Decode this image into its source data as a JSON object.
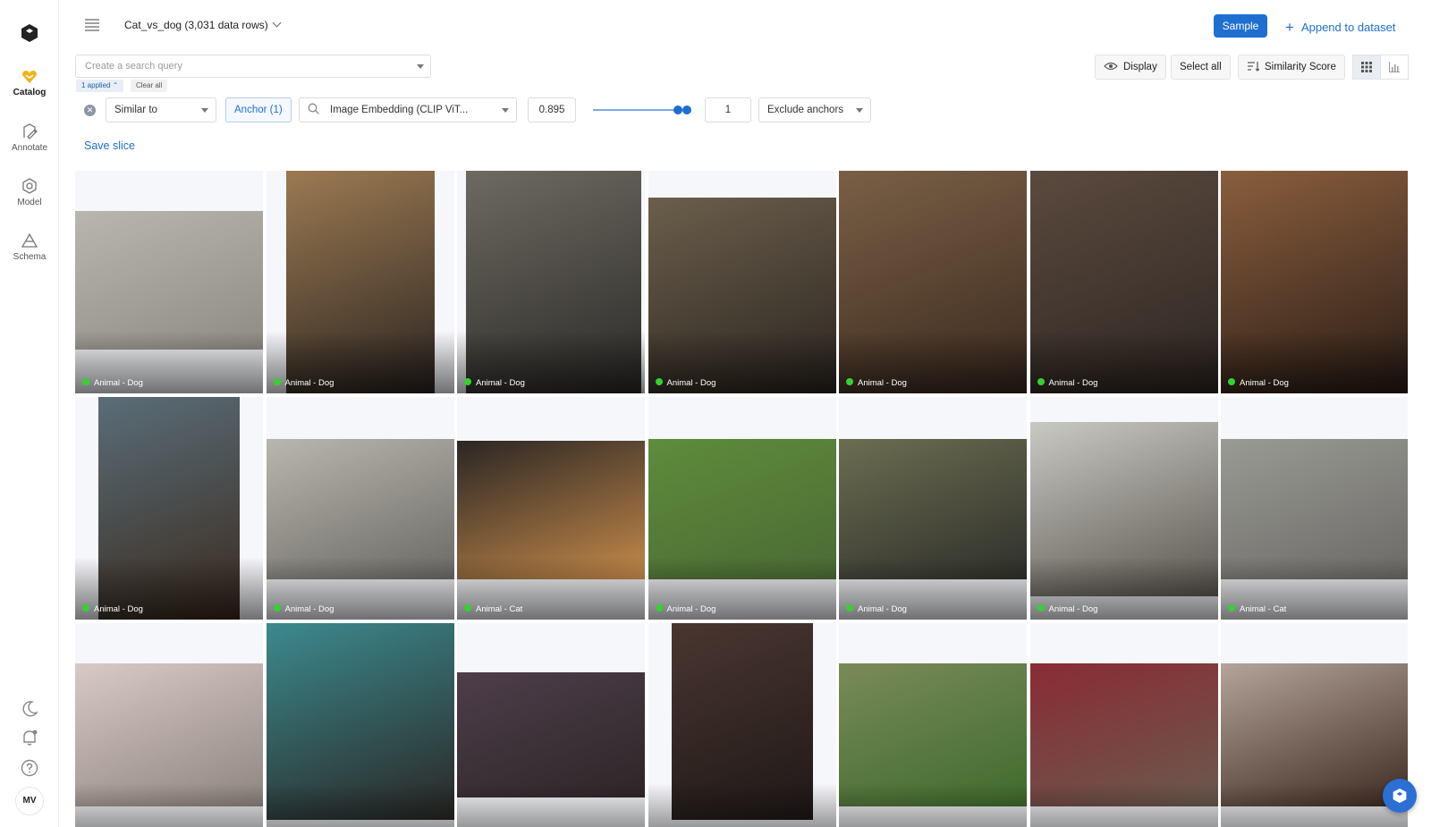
{
  "sidebar": {
    "items": [
      {
        "label": "Catalog",
        "icon": "catalog-icon",
        "active": true
      },
      {
        "label": "Annotate",
        "icon": "annotate-icon",
        "active": false
      },
      {
        "label": "Model",
        "icon": "model-icon",
        "active": false
      },
      {
        "label": "Schema",
        "icon": "schema-icon",
        "active": false
      }
    ],
    "bottom_icons": [
      "moon-icon",
      "bell-icon",
      "help-icon"
    ],
    "avatar": "MV"
  },
  "header": {
    "dataset_title": "Cat_vs_dog (3,031 data rows)",
    "sample_label": "Sample",
    "append_label": "Append to dataset"
  },
  "search": {
    "placeholder": "Create a search query",
    "applied_chip": "1 applied",
    "clear_all": "Clear all"
  },
  "toolbar": {
    "display_label": "Display",
    "select_all_label": "Select all",
    "similarity_label": "Similarity Score",
    "view_grid": "grid-view-icon",
    "view_chart": "chart-view-icon"
  },
  "filter": {
    "operator": "Similar to",
    "anchor": "Anchor (1)",
    "embedding": "Image Embedding (CLIP ViT...",
    "min_score": "0.895",
    "max_score": "1",
    "exclude": "Exclude anchors",
    "slider_range": [
      0.895,
      1
    ]
  },
  "save_slice_label": "Save slice",
  "grid": {
    "tiles": [
      {
        "label": "Animal - Dog"
      },
      {
        "label": "Animal - Dog"
      },
      {
        "label": "Animal - Dog"
      },
      {
        "label": "Animal - Dog"
      },
      {
        "label": "Animal - Dog"
      },
      {
        "label": "Animal - Dog"
      },
      {
        "label": "Animal - Dog"
      },
      {
        "label": "Animal - Dog"
      },
      {
        "label": "Animal - Dog"
      },
      {
        "label": "Animal - Cat"
      },
      {
        "label": "Animal - Dog"
      },
      {
        "label": "Animal - Dog"
      },
      {
        "label": "Animal - Dog"
      },
      {
        "label": "Animal - Cat"
      },
      {
        "label": ""
      },
      {
        "label": ""
      },
      {
        "label": ""
      },
      {
        "label": ""
      },
      {
        "label": ""
      },
      {
        "label": ""
      },
      {
        "label": ""
      }
    ]
  },
  "colors": {
    "accent": "#1f6fd1",
    "label_dot": "#36d130"
  }
}
